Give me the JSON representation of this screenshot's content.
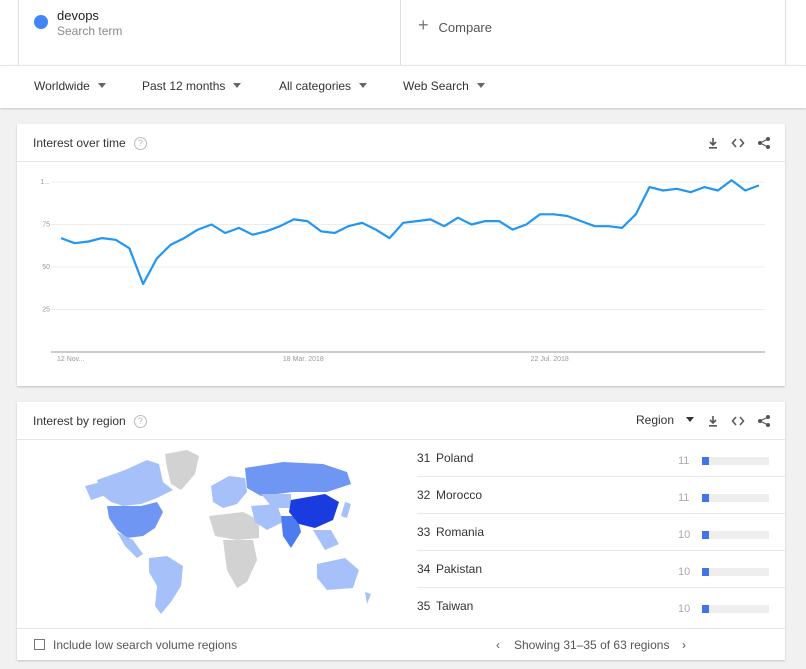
{
  "search_term": {
    "name": "devops",
    "subtitle": "Search term"
  },
  "compare": {
    "label": "Compare"
  },
  "filters": [
    {
      "label": "Worldwide"
    },
    {
      "label": "Past 12 months"
    },
    {
      "label": "All categories"
    },
    {
      "label": "Web Search"
    }
  ],
  "interest_over_time": {
    "title": "Interest over time",
    "help": "?"
  },
  "interest_by_region": {
    "title": "Interest by region",
    "help": "?",
    "resolution_label": "Region",
    "rows": [
      {
        "rank": "31",
        "name": "Poland",
        "value": "11",
        "level": 0.11
      },
      {
        "rank": "32",
        "name": "Morocco",
        "value": "11",
        "level": 0.11
      },
      {
        "rank": "33",
        "name": "Romania",
        "value": "10",
        "level": 0.1
      },
      {
        "rank": "34",
        "name": "Pakistan",
        "value": "10",
        "level": 0.1
      },
      {
        "rank": "35",
        "name": "Taiwan",
        "value": "10",
        "level": 0.1
      }
    ],
    "include_low_volume_label": "Include low search volume regions",
    "pagination_label": "Showing 31–35 of 63 regions"
  },
  "icons": {
    "download": "download-icon",
    "embed": "embed-icon",
    "share": "share-icon",
    "prev": "chevron-left-icon",
    "next": "chevron-right-icon"
  },
  "colors": {
    "series": "#2196f3",
    "term_dot": "#4285f4",
    "map_high": "#1a3be0",
    "map_mid": "#4d7cf0",
    "map_low": "#a6c1fa",
    "map_none": "#d2d2d2"
  },
  "chart_data": {
    "type": "line",
    "title": "Interest over time",
    "x_tick_labels": [
      "12 Nov...",
      "18 Mar. 2018",
      "22 Jul. 2018"
    ],
    "y_tick_labels": [
      "1...",
      "75",
      "50",
      "25"
    ],
    "ylim": [
      0,
      100
    ],
    "grid": true,
    "series": [
      {
        "values": [
          67,
          64,
          65,
          67,
          66,
          61,
          40,
          55,
          63,
          67,
          72,
          75,
          70,
          73,
          69,
          71,
          74,
          78,
          77,
          71,
          70,
          74,
          76,
          72,
          67,
          76,
          77,
          78,
          74,
          79,
          75,
          77,
          77,
          72,
          75,
          81,
          81,
          80,
          77,
          74,
          74,
          73,
          81,
          97,
          95,
          96,
          94,
          97,
          95,
          101,
          95,
          98
        ]
      }
    ]
  }
}
